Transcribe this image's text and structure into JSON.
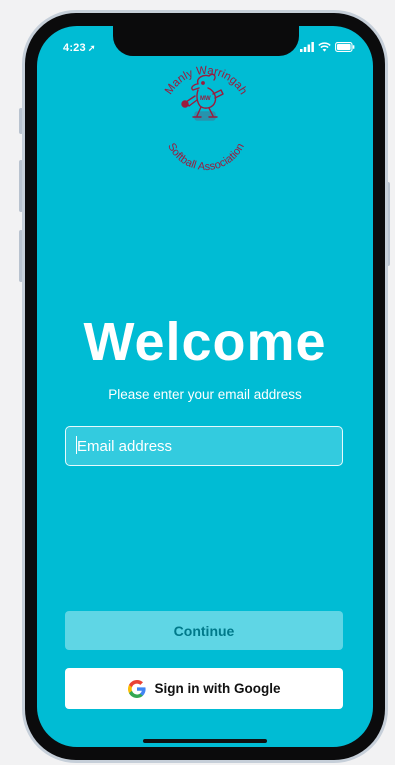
{
  "status_bar": {
    "time": "4:23",
    "location_icon": "location-arrow-icon",
    "signal_icon": "cellular-signal-icon",
    "wifi_icon": "wifi-icon",
    "battery_icon": "battery-icon"
  },
  "logo": {
    "top_text": "Manly Warringah",
    "bottom_text": "Softball Association",
    "badge_text": "MW",
    "color": "#9b1b3d"
  },
  "welcome": {
    "title": "Welcome",
    "subtitle": "Please enter your email address"
  },
  "email": {
    "placeholder": "Email address",
    "value": ""
  },
  "buttons": {
    "continue_label": "Continue",
    "google_label": "Sign in with Google",
    "google_icon": "google-g-icon"
  },
  "colors": {
    "screen_background": "#00bcd4",
    "continue_background": "#5fd6e5",
    "continue_text": "#00798a",
    "logo": "#9b1b3d"
  }
}
